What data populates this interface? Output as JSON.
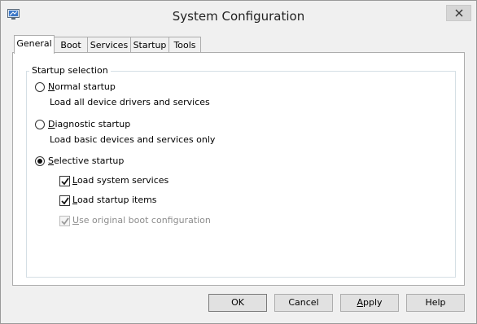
{
  "window": {
    "title": "System Configuration"
  },
  "tabs": [
    {
      "label": "General",
      "active": true
    },
    {
      "label": "Boot"
    },
    {
      "label": "Services"
    },
    {
      "label": "Startup"
    },
    {
      "label": "Tools"
    }
  ],
  "startup_selection": {
    "legend": "Startup selection",
    "normal": {
      "first": "N",
      "rest": "ormal startup",
      "desc": "Load all device drivers and services",
      "selected": false
    },
    "diagnostic": {
      "first": "D",
      "rest": "iagnostic startup",
      "desc": "Load basic devices and services only",
      "selected": false
    },
    "selective": {
      "first": "S",
      "rest": "elective startup",
      "selected": true,
      "options": {
        "system_services": {
          "first": "L",
          "rest": "oad system services",
          "checked": true
        },
        "startup_items": {
          "first": "L",
          "rest": "oad startup items",
          "checked": true
        },
        "original_boot": {
          "first": "U",
          "rest": "se original boot configuration",
          "checked": true,
          "disabled": true
        }
      }
    }
  },
  "buttons": {
    "ok": "OK",
    "cancel": "Cancel",
    "apply_first": "A",
    "apply_rest": "pply",
    "help": "Help"
  },
  "icons": {
    "app": "system-configuration-icon",
    "close": "close-icon"
  }
}
